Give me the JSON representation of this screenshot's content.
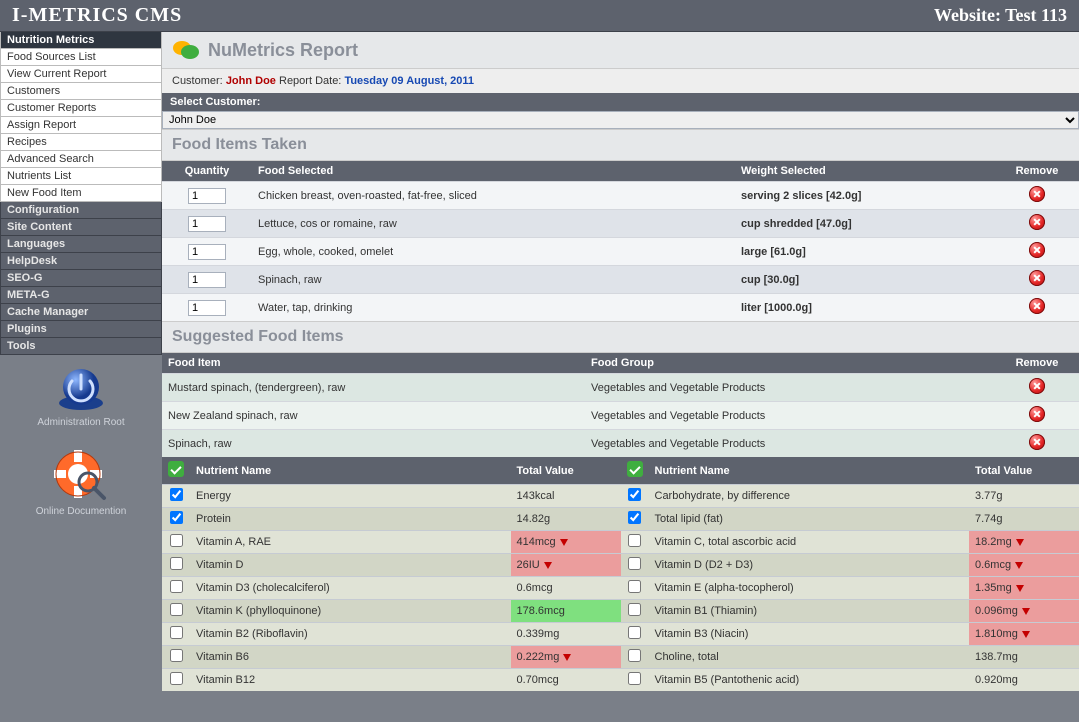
{
  "brand": "I-METRICS CMS",
  "website_label": "Website: Test 113",
  "sidebar": {
    "active": "Nutrition Metrics",
    "items": [
      "Food Sources List",
      "View Current Report",
      "Customers",
      "Customer Reports",
      "Assign Report",
      "Recipes",
      "Advanced Search",
      "Nutrients List",
      "New Food Item"
    ],
    "groups": [
      "Configuration",
      "Site Content",
      "Languages",
      "HelpDesk",
      "SEO-G",
      "META-G",
      "Cache Manager",
      "Plugins",
      "Tools"
    ],
    "admin_root": "Administration Root",
    "online_doc": "Online Documention"
  },
  "report": {
    "title": "NuMetrics Report",
    "customer_label": "Customer:",
    "customer_name": "John Doe",
    "date_label": "Report Date:",
    "date_value": "Tuesday 09 August, 2011",
    "select_label": "Select Customer:",
    "select_value": "John Doe"
  },
  "food_taken": {
    "title": "Food Items Taken",
    "cols": {
      "qty": "Quantity",
      "food": "Food Selected",
      "weight": "Weight Selected",
      "remove": "Remove"
    },
    "rows": [
      {
        "qty": "1",
        "food": "Chicken breast, oven-roasted, fat-free, sliced",
        "weight": "serving 2 slices [42.0g]"
      },
      {
        "qty": "1",
        "food": "Lettuce, cos or romaine, raw",
        "weight": "cup shredded [47.0g]"
      },
      {
        "qty": "1",
        "food": "Egg, whole, cooked, omelet",
        "weight": "large [61.0g]"
      },
      {
        "qty": "1",
        "food": "Spinach, raw",
        "weight": "cup [30.0g]"
      },
      {
        "qty": "1",
        "food": "Water, tap, drinking",
        "weight": "liter [1000.0g]"
      }
    ]
  },
  "suggested": {
    "title": "Suggested Food Items",
    "cols": {
      "item": "Food Item",
      "group": "Food Group",
      "remove": "Remove"
    },
    "rows": [
      {
        "item": "Mustard spinach, (tendergreen), raw",
        "group": "Vegetables and Vegetable Products"
      },
      {
        "item": "New Zealand spinach, raw",
        "group": "Vegetables and Vegetable Products"
      },
      {
        "item": "Spinach, raw",
        "group": "Vegetables and Vegetable Products"
      }
    ]
  },
  "nutrients": {
    "cols": {
      "name": "Nutrient Name",
      "value": "Total Value"
    },
    "left": [
      {
        "chk": true,
        "name": "Energy",
        "value": "143kcal",
        "status": ""
      },
      {
        "chk": true,
        "name": "Protein",
        "value": "14.82g",
        "status": ""
      },
      {
        "chk": false,
        "name": "Vitamin A, RAE",
        "value": "414mcg",
        "status": "low"
      },
      {
        "chk": false,
        "name": "Vitamin D",
        "value": "26IU",
        "status": "low"
      },
      {
        "chk": false,
        "name": "Vitamin D3 (cholecalciferol)",
        "value": "0.6mcg",
        "status": ""
      },
      {
        "chk": false,
        "name": "Vitamin K (phylloquinone)",
        "value": "178.6mcg",
        "status": "high"
      },
      {
        "chk": false,
        "name": "Vitamin B2 (Riboflavin)",
        "value": "0.339mg",
        "status": ""
      },
      {
        "chk": false,
        "name": "Vitamin B6",
        "value": "0.222mg",
        "status": "low"
      },
      {
        "chk": false,
        "name": "Vitamin B12",
        "value": "0.70mcg",
        "status": ""
      }
    ],
    "right": [
      {
        "chk": true,
        "name": "Carbohydrate, by difference",
        "value": "3.77g",
        "status": ""
      },
      {
        "chk": true,
        "name": "Total lipid (fat)",
        "value": "7.74g",
        "status": ""
      },
      {
        "chk": false,
        "name": "Vitamin C, total ascorbic acid",
        "value": "18.2mg",
        "status": "low"
      },
      {
        "chk": false,
        "name": "Vitamin D (D2 + D3)",
        "value": "0.6mcg",
        "status": "low"
      },
      {
        "chk": false,
        "name": "Vitamin E (alpha-tocopherol)",
        "value": "1.35mg",
        "status": "low"
      },
      {
        "chk": false,
        "name": "Vitamin B1 (Thiamin)",
        "value": "0.096mg",
        "status": "low"
      },
      {
        "chk": false,
        "name": "Vitamin B3 (Niacin)",
        "value": "1.810mg",
        "status": "low"
      },
      {
        "chk": false,
        "name": "Choline, total",
        "value": "138.7mg",
        "status": ""
      },
      {
        "chk": false,
        "name": "Vitamin B5 (Pantothenic acid)",
        "value": "0.920mg",
        "status": ""
      }
    ]
  }
}
